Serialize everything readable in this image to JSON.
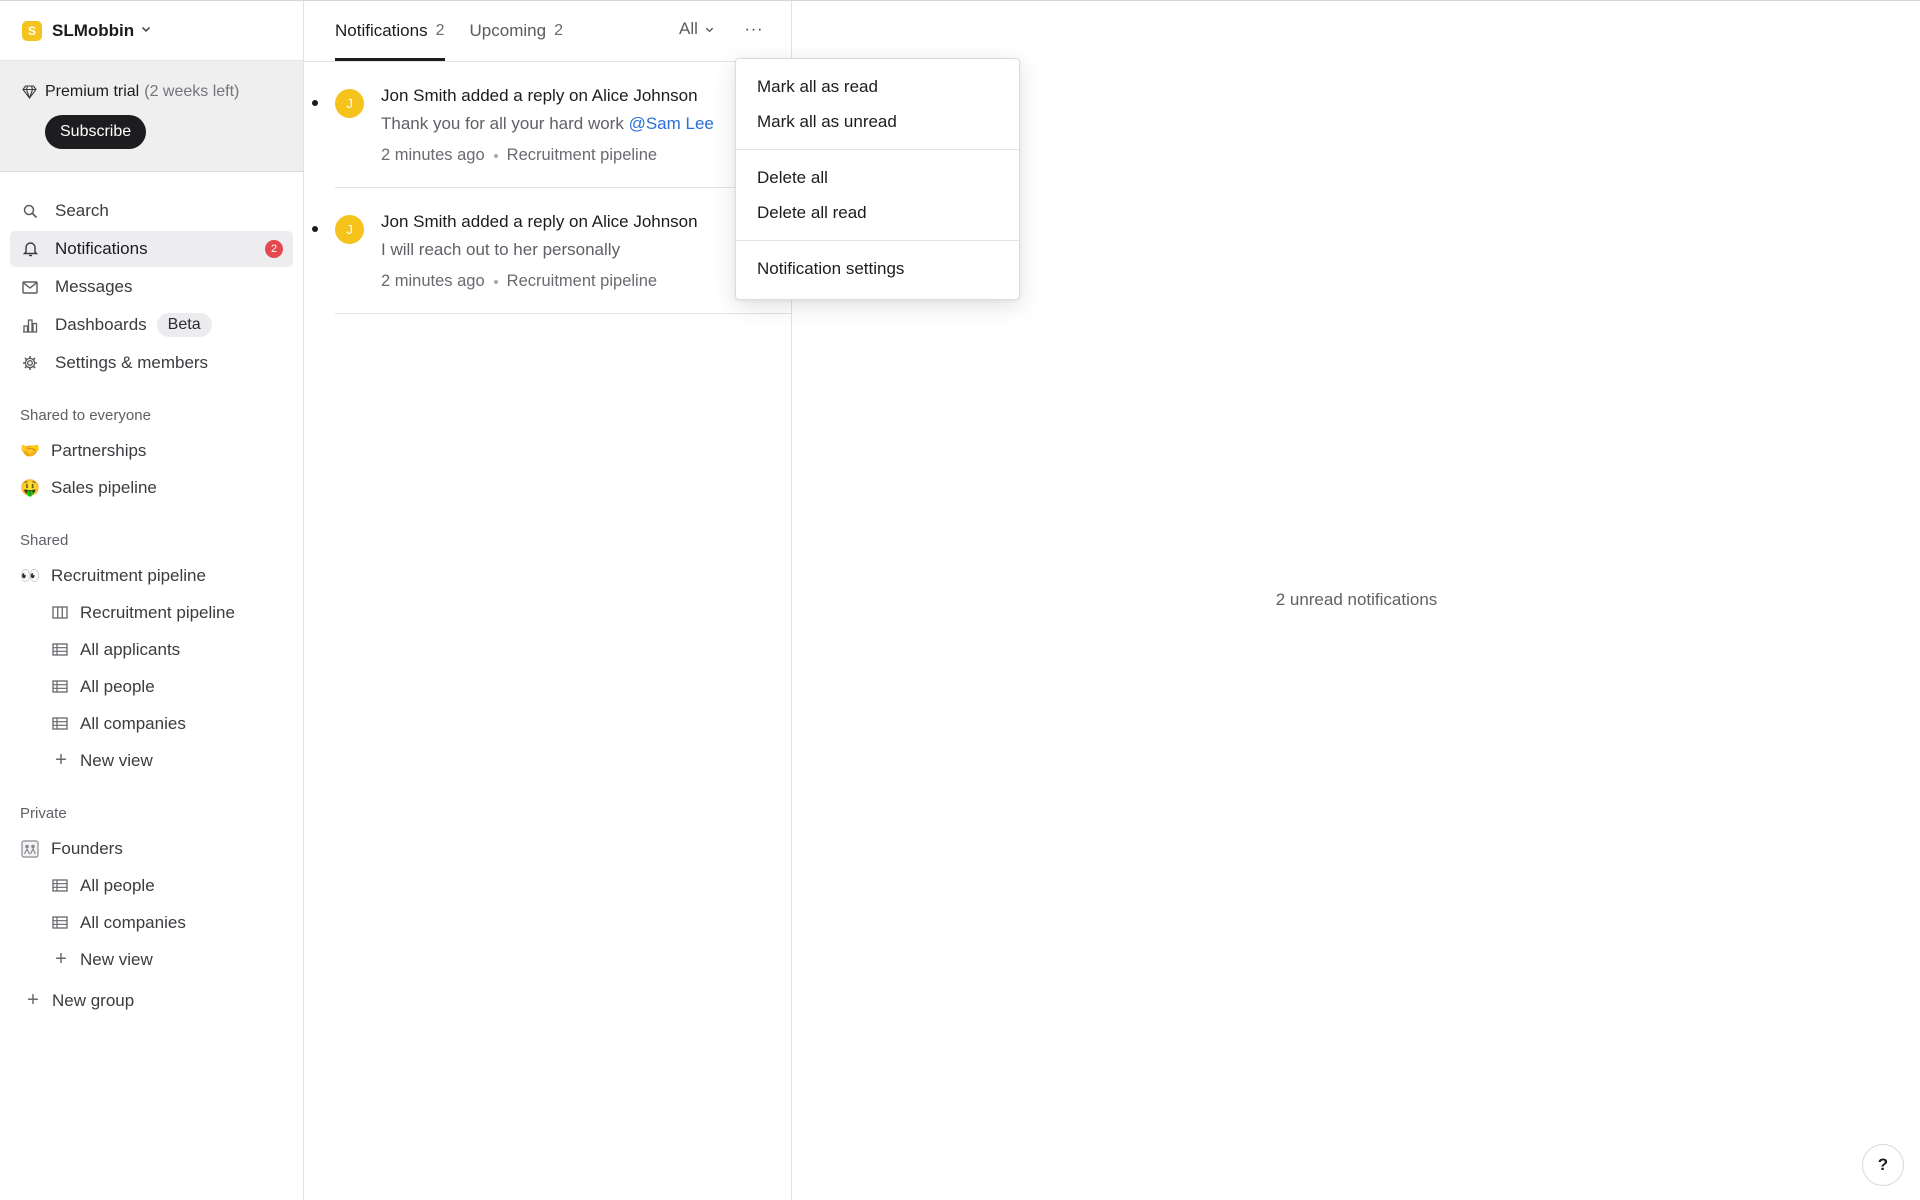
{
  "workspace": {
    "name": "SLMobbin",
    "logo_letter": "S"
  },
  "trial": {
    "label": "Premium trial",
    "remaining": "(2 weeks left)",
    "subscribe_label": "Subscribe"
  },
  "nav": {
    "search": "Search",
    "notifications": "Notifications",
    "notifications_count": "2",
    "messages": "Messages",
    "dashboards": "Dashboards",
    "dashboards_badge": "Beta",
    "settings": "Settings & members"
  },
  "sections": {
    "shared_everyone": {
      "label": "Shared to everyone",
      "items": [
        {
          "emoji": "🤝",
          "label": "Partnerships"
        },
        {
          "emoji": "🤑",
          "label": "Sales pipeline"
        }
      ]
    },
    "shared": {
      "label": "Shared",
      "group": {
        "emoji": "👀",
        "label": "Recruitment pipeline"
      },
      "views": [
        "Recruitment pipeline",
        "All applicants",
        "All people",
        "All companies"
      ],
      "new_view": "New view"
    },
    "private": {
      "label": "Private",
      "group": {
        "label": "Founders"
      },
      "views": [
        "All people",
        "All companies"
      ],
      "new_view": "New view"
    },
    "new_group": "New group"
  },
  "tabs": [
    {
      "label": "Notifications",
      "count": "2"
    },
    {
      "label": "Upcoming",
      "count": "2"
    }
  ],
  "filter": {
    "label": "All"
  },
  "more_label": "···",
  "notifications": [
    {
      "avatar": "J",
      "title": "Jon Smith added a reply on Alice Johnson",
      "body": "Thank you for all your hard work ",
      "mention": "@Sam Lee",
      "time": "2 minutes ago",
      "source": "Recruitment pipeline"
    },
    {
      "avatar": "J",
      "title": "Jon Smith added a reply on Alice Johnson",
      "body": "I will reach out to her personally",
      "mention": "",
      "time": "2 minutes ago",
      "source": "Recruitment pipeline"
    }
  ],
  "menu": {
    "mark_read": "Mark all as read",
    "mark_unread": "Mark all as unread",
    "delete_all": "Delete all",
    "delete_read": "Delete all read",
    "settings": "Notification settings"
  },
  "detail": {
    "empty_text": "2 unread notifications"
  },
  "help_label": "?",
  "colors": {
    "accent_yellow": "#f6c21c",
    "badge_red": "#e5484d",
    "mention_blue": "#2a6fdb"
  }
}
